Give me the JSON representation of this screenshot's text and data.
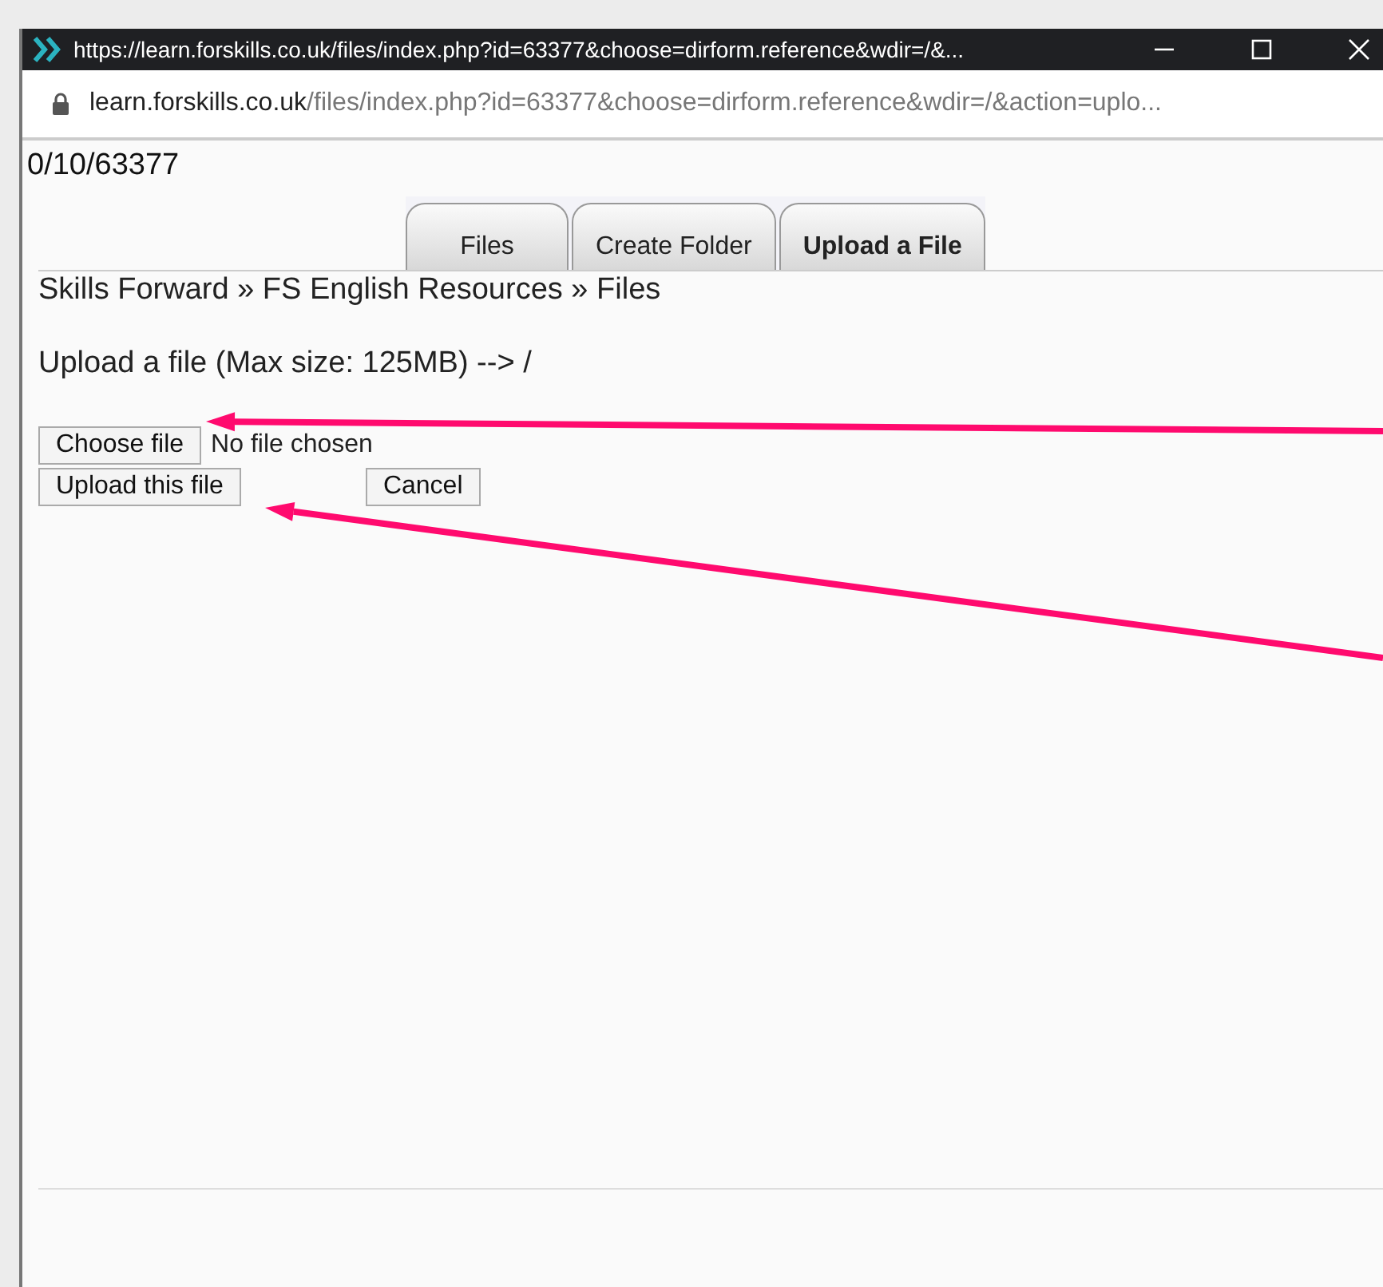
{
  "window": {
    "title": "https://learn.forskills.co.uk/files/index.php?id=63377&choose=dirform.reference&wdir=/&...",
    "controls": [
      {
        "kind": "minimize"
      },
      {
        "kind": "maximize"
      },
      {
        "kind": "close"
      }
    ]
  },
  "address_bar": {
    "host": "learn.forskills.co.uk",
    "path": "/files/index.php?id=63377&choose=dirform.reference&wdir=/&action=uplo..."
  },
  "page_path": "0/10/63377",
  "tabs": [
    {
      "label": "Files",
      "selected": false
    },
    {
      "label": "Create Folder",
      "selected": false
    },
    {
      "label": "Upload a File",
      "selected": true
    }
  ],
  "breadcrumb": "Skills Forward » FS English Resources » Files",
  "upload_heading": "Upload a file (Max size: 125MB) --> /",
  "choose_button": "Choose file",
  "file_status": "No file chosen",
  "upload_button": "Upload this file",
  "cancel_button": "Cancel",
  "annotation_arrows": [
    {
      "kind": "arrow"
    },
    {
      "kind": "arrow"
    }
  ]
}
